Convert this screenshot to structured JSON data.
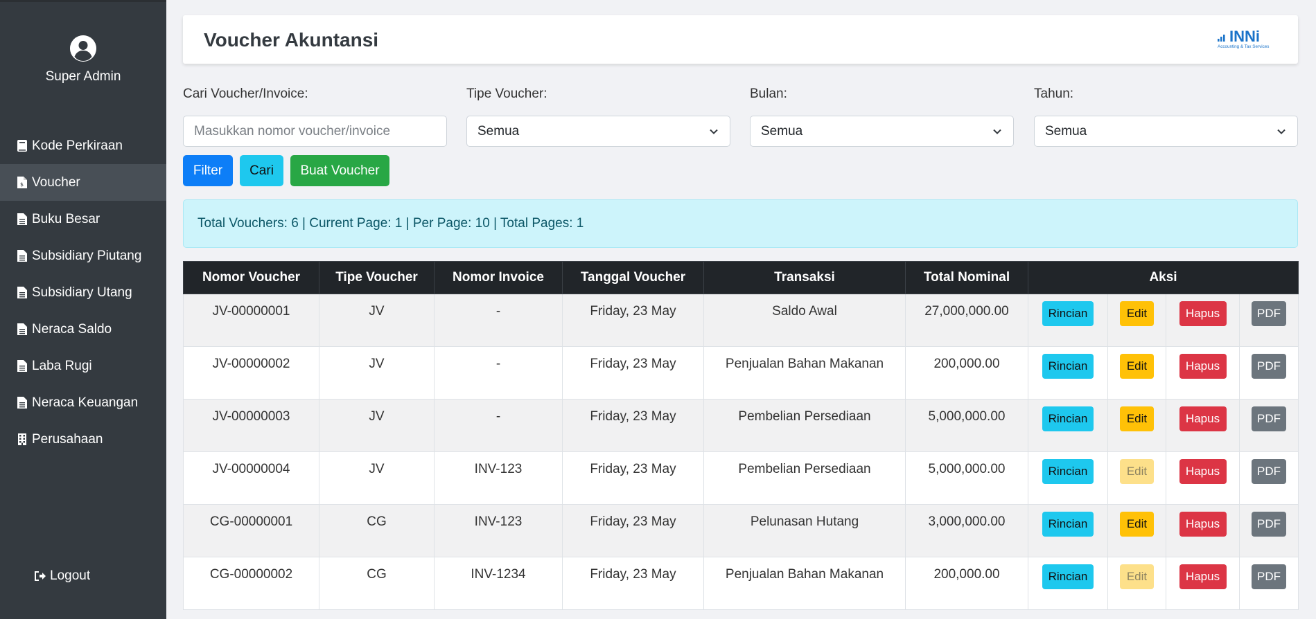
{
  "sidebar": {
    "user_name": "Super Admin",
    "items": [
      {
        "label": "Kode Perkiraan",
        "icon": "book-icon",
        "active": false
      },
      {
        "label": "Voucher",
        "icon": "file-invoice-dollar-icon",
        "active": true
      },
      {
        "label": "Buku Besar",
        "icon": "file-icon",
        "active": false
      },
      {
        "label": "Subsidiary Piutang",
        "icon": "file-icon",
        "active": false
      },
      {
        "label": "Subsidiary Utang",
        "icon": "file-icon",
        "active": false
      },
      {
        "label": "Neraca Saldo",
        "icon": "file-icon",
        "active": false
      },
      {
        "label": "Laba Rugi",
        "icon": "file-icon",
        "active": false
      },
      {
        "label": "Neraca Keuangan",
        "icon": "file-icon",
        "active": false
      },
      {
        "label": "Perusahaan",
        "icon": "building-icon",
        "active": false
      }
    ],
    "logout_label": "Logout"
  },
  "header": {
    "title": "Voucher Akuntansi",
    "logo_text": "INNi",
    "logo_subtext": "Accounting & Tax Services"
  },
  "filters": {
    "search_label": "Cari Voucher/Invoice:",
    "search_placeholder": "Masukkan nomor voucher/invoice",
    "search_value": "",
    "type_label": "Tipe Voucher:",
    "type_value": "Semua",
    "month_label": "Bulan:",
    "month_value": "Semua",
    "year_label": "Tahun:",
    "year_value": "Semua"
  },
  "buttons": {
    "filter": "Filter",
    "search": "Cari",
    "create": "Buat Voucher"
  },
  "summary": "Total Vouchers: 6 | Current Page: 1 | Per Page: 10 | Total Pages: 1",
  "table": {
    "headers": [
      "Nomor Voucher",
      "Tipe Voucher",
      "Nomor Invoice",
      "Tanggal Voucher",
      "Transaksi",
      "Total Nominal",
      "Aksi"
    ],
    "actions": {
      "detail": "Rincian",
      "edit": "Edit",
      "delete": "Hapus",
      "pdf": "PDF"
    },
    "rows": [
      {
        "voucher": "JV-00000001",
        "type": "JV",
        "invoice": "-",
        "date": "Friday, 23 May",
        "transaction": "Saldo Awal",
        "total": "27,000,000.00",
        "edit_enabled": true
      },
      {
        "voucher": "JV-00000002",
        "type": "JV",
        "invoice": "-",
        "date": "Friday, 23 May",
        "transaction": "Penjualan Bahan Makanan",
        "total": "200,000.00",
        "edit_enabled": true
      },
      {
        "voucher": "JV-00000003",
        "type": "JV",
        "invoice": "-",
        "date": "Friday, 23 May",
        "transaction": "Pembelian Persediaan",
        "total": "5,000,000.00",
        "edit_enabled": true
      },
      {
        "voucher": "JV-00000004",
        "type": "JV",
        "invoice": "INV-123",
        "date": "Friday, 23 May",
        "transaction": "Pembelian Persediaan",
        "total": "5,000,000.00",
        "edit_enabled": false
      },
      {
        "voucher": "CG-00000001",
        "type": "CG",
        "invoice": "INV-123",
        "date": "Friday, 23 May",
        "transaction": "Pelunasan Hutang",
        "total": "3,000,000.00",
        "edit_enabled": true
      },
      {
        "voucher": "CG-00000002",
        "type": "CG",
        "invoice": "INV-1234",
        "date": "Friday, 23 May",
        "transaction": "Penjualan Bahan Makanan",
        "total": "200,000.00",
        "edit_enabled": false
      }
    ]
  },
  "colors": {
    "sidebar_bg": "#343a40",
    "primary": "#0d7ef7",
    "info": "#1ec8ee",
    "success": "#28a745",
    "warning": "#ffc107",
    "danger": "#dc3545",
    "secondary": "#6c757d",
    "logo_blue": "#1a73c9"
  }
}
